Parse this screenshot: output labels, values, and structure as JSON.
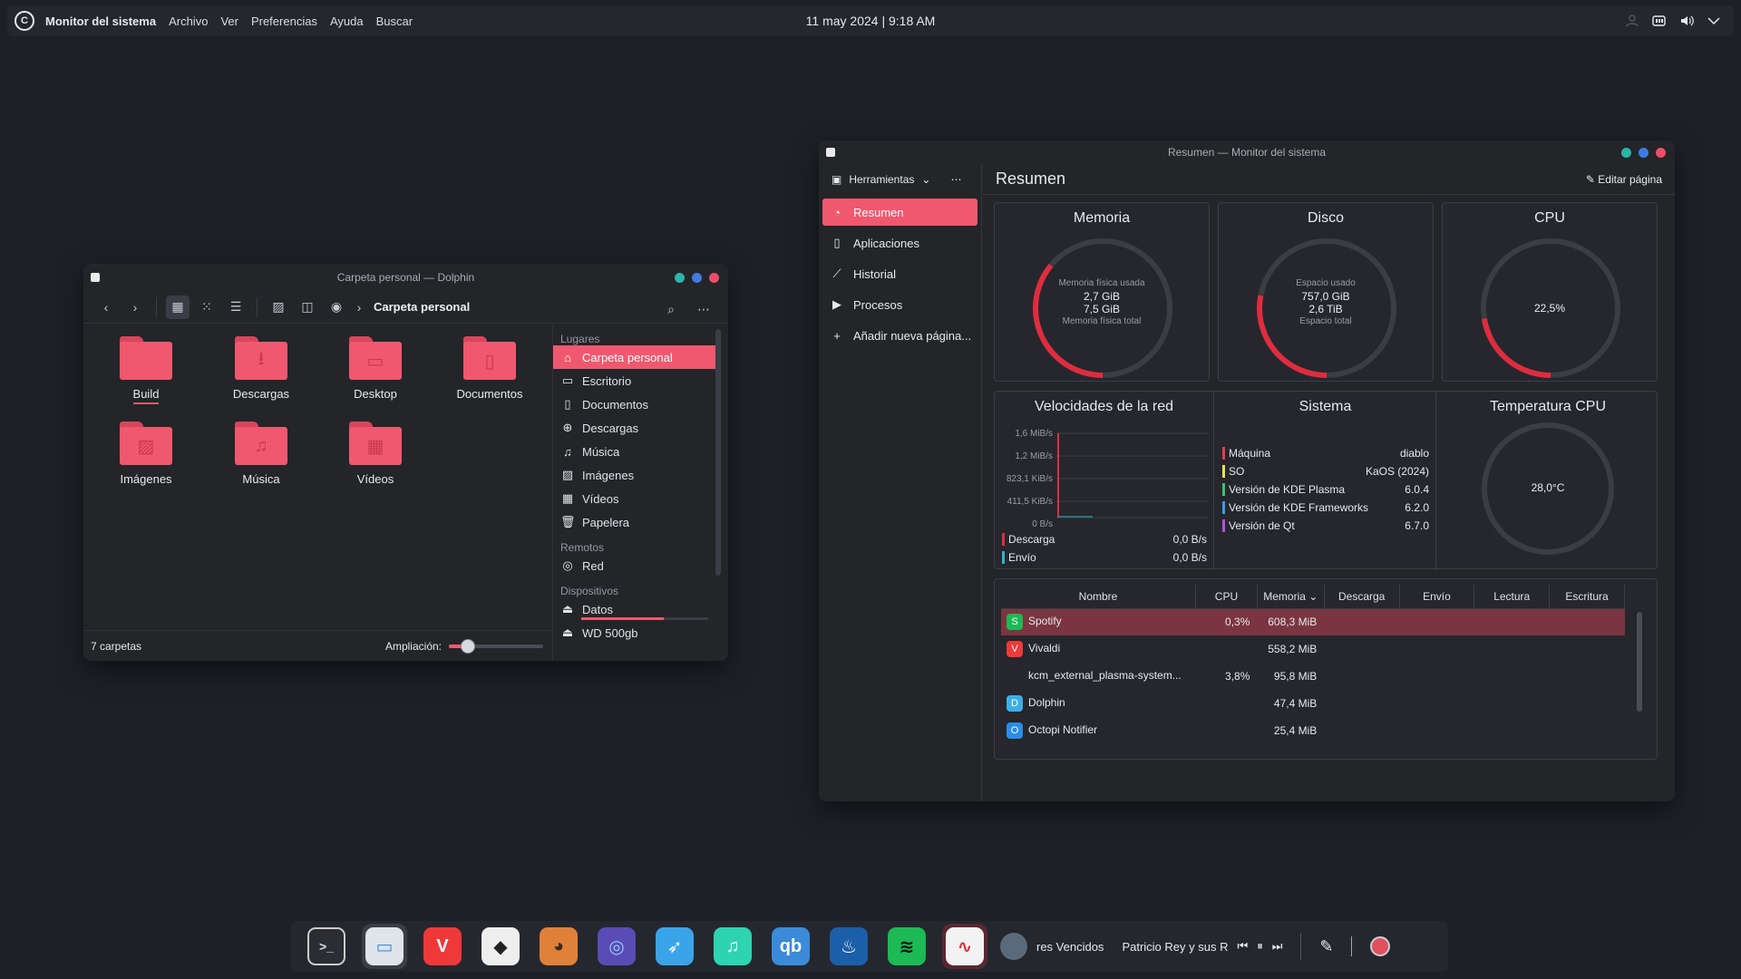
{
  "top_panel": {
    "app_name": "Monitor del sistema",
    "menu": [
      "Archivo",
      "Ver",
      "Preferencias",
      "Ayuda",
      "Buscar"
    ],
    "clock": "11 may 2024 | 9:18 AM",
    "tray_icons": [
      "people-icon",
      "battery-icon",
      "volume-icon",
      "chevron-down-icon"
    ]
  },
  "dolphin": {
    "title": "Carpeta personal — Dolphin",
    "path": "Carpeta personal",
    "folders": [
      {
        "label": "Build",
        "icon": "folder-icon"
      },
      {
        "label": "Descargas",
        "icon": "download-icon"
      },
      {
        "label": "Desktop",
        "icon": "desktop-icon"
      },
      {
        "label": "Documentos",
        "icon": "document-icon"
      },
      {
        "label": "Imágenes",
        "icon": "image-icon"
      },
      {
        "label": "Música",
        "icon": "music-icon"
      },
      {
        "label": "Vídeos",
        "icon": "video-icon"
      }
    ],
    "places": {
      "section_lugares": "Lugares",
      "lugares": [
        "Carpeta personal",
        "Escritorio",
        "Documentos",
        "Descargas",
        "Música",
        "Imágenes",
        "Vídeos",
        "Papelera"
      ],
      "section_remotos": "Remotos",
      "remotos": [
        "Red"
      ],
      "section_dispositivos": "Dispositivos",
      "dispositivos": [
        "Datos",
        "WD 500gb"
      ],
      "datos_usage_fraction": 0.65
    },
    "status": "7 carpetas",
    "zoom_label": "Ampliación:",
    "zoom_fraction": 0.2
  },
  "sysmon": {
    "title": "Resumen — Monitor del sistema",
    "tools_label": "Herramientas",
    "nav": [
      "Resumen",
      "Aplicaciones",
      "Historial",
      "Procesos",
      "Añadir nueva página..."
    ],
    "page_title": "Resumen",
    "edit_label": "Editar página",
    "memory": {
      "title": "Memoria",
      "used_label": "Memoria física usada",
      "used": "2,7 GiB",
      "total": "7,5 GiB",
      "total_label": "Memoria física total",
      "fraction": 0.36
    },
    "disk": {
      "title": "Disco",
      "used_label": "Espacio usado",
      "used": "757,0 GiB",
      "total": "2,6 TiB",
      "total_label": "Espacio total",
      "fraction": 0.28
    },
    "cpu": {
      "title": "CPU",
      "value": "22,5%",
      "fraction": 0.225
    },
    "network": {
      "title": "Velocidades de la red",
      "yticks": [
        "1,6 MiB/s",
        "1,2 MiB/s",
        "823,1 KiB/s",
        "411,5 KiB/s",
        "0 B/s"
      ],
      "download_label": "Descarga",
      "download_value": "0,0 B/s",
      "upload_label": "Envío",
      "upload_value": "0,0 B/s"
    },
    "system": {
      "title": "Sistema",
      "rows": [
        {
          "label": "Máquina",
          "value": "diablo",
          "color": "#e8394f"
        },
        {
          "label": "SO",
          "value": "KaOS (2024)",
          "color": "#e6e24c"
        },
        {
          "label": "Versión de KDE Plasma",
          "value": "6.0.4",
          "color": "#3ac46a"
        },
        {
          "label": "Versión de KDE Frameworks",
          "value": "6.2.0",
          "color": "#3a9de6"
        },
        {
          "label": "Versión de Qt",
          "value": "6.7.0",
          "color": "#b84fd6"
        }
      ]
    },
    "cpu_temp": {
      "title": "Temperatura CPU",
      "value": "28,0°C"
    },
    "table": {
      "headers": [
        "Nombre",
        "CPU",
        "Memoria",
        "Descarga",
        "Envío",
        "Lectura",
        "Escritura"
      ],
      "rows": [
        {
          "name": "Spotify",
          "cpu": "0,3%",
          "mem": "608,3 MiB",
          "icon": "spotify-icon",
          "color": "#1db954"
        },
        {
          "name": "Vivaldi",
          "cpu": "",
          "mem": "558,2 MiB",
          "icon": "vivaldi-icon",
          "color": "#ef3939"
        },
        {
          "name": "kcm_external_plasma-system...",
          "cpu": "3,8%",
          "mem": "95,8 MiB",
          "icon": "",
          "color": ""
        },
        {
          "name": "Dolphin",
          "cpu": "",
          "mem": "47,4 MiB",
          "icon": "dolphin-icon",
          "color": "#3daee9"
        },
        {
          "name": "Octopi Notifier",
          "cpu": "",
          "mem": "25,4 MiB",
          "icon": "octopi-icon",
          "color": "#2a8de8"
        }
      ]
    }
  },
  "dock": {
    "apps": [
      "terminal-icon",
      "files-icon",
      "vivaldi-icon",
      "inkscape-icon",
      "gimp-icon",
      "kdeconnect-icon",
      "swift-icon",
      "music-icon",
      "qbittorrent-icon",
      "steam-icon",
      "spotify-icon",
      "sysmon-icon"
    ],
    "track": "res Vencidos",
    "artist": "Patricio Rey y sus R"
  }
}
